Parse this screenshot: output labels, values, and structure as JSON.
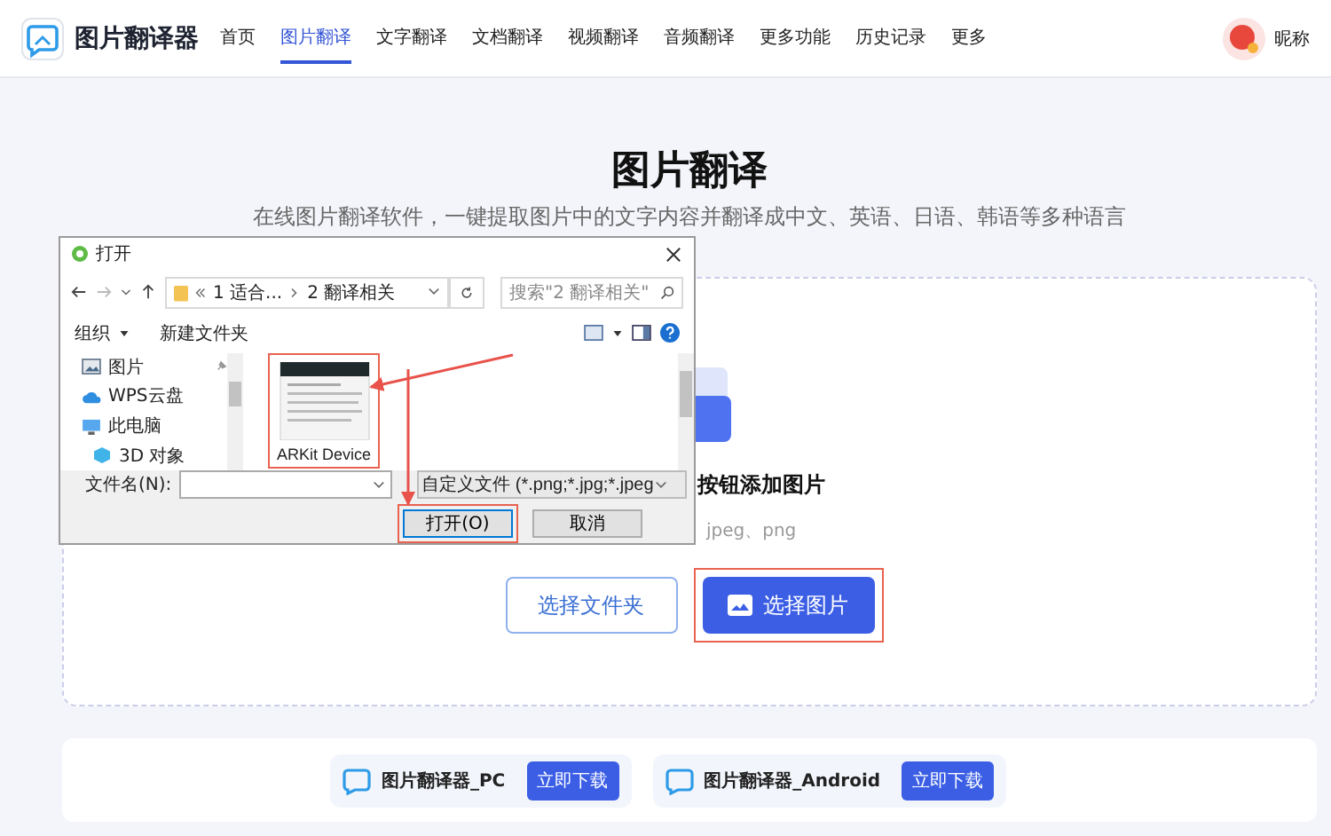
{
  "app": {
    "name": "图片翻译器"
  },
  "nav": [
    {
      "label": "首页",
      "selected": false
    },
    {
      "label": "图片翻译",
      "selected": true
    },
    {
      "label": "文字翻译",
      "selected": false
    },
    {
      "label": "文档翻译",
      "selected": false
    },
    {
      "label": "视频翻译",
      "selected": false
    },
    {
      "label": "音频翻译",
      "selected": false
    },
    {
      "label": "更多功能",
      "selected": false
    },
    {
      "label": "历史记录",
      "selected": false
    },
    {
      "label": "更多",
      "selected": false
    }
  ],
  "user": {
    "name": "昵称"
  },
  "hero": {
    "title": "图片翻译",
    "subtitle": "在线图片翻译软件，一键提取图片中的文字内容并翻译成中文、英语、日语、韩语等多种语言"
  },
  "upload": {
    "hint": "按钮添加图片",
    "formats": "jpeg、png",
    "buttons": [
      {
        "label": "选择文件夹",
        "kind": "outline",
        "highlighted": false
      },
      {
        "label": "选择图片",
        "kind": "primary",
        "highlighted": true
      }
    ]
  },
  "downloads": [
    {
      "name": "图片翻译器_PC",
      "button": "立即下载"
    },
    {
      "name": "图片翻译器_Android",
      "button": "立即下载"
    }
  ],
  "dialog": {
    "title": "打开",
    "breadcrumb": [
      "1 适合...",
      "2 翻译相关"
    ],
    "search": {
      "placeholder": "搜索\"2 翻译相关\""
    },
    "toolbar": {
      "organize": "组织",
      "new_folder": "新建文件夹"
    },
    "places": [
      {
        "label": "图片",
        "kind": "pictures",
        "pinned": true
      },
      {
        "label": "WPS云盘",
        "kind": "cloud",
        "pinned": false
      },
      {
        "label": "此电脑",
        "kind": "computer",
        "pinned": false
      },
      {
        "label": "3D 对象",
        "kind": "cube",
        "pinned": false
      }
    ],
    "files": [
      {
        "name": "ARKit Device",
        "highlighted": true
      }
    ],
    "filename_label": "文件名(N):",
    "filetype": "自定义文件 (*.png;*.jpg;*.jpeg",
    "open": {
      "label": "打开(O)",
      "highlighted": true
    },
    "cancel": "取消"
  }
}
